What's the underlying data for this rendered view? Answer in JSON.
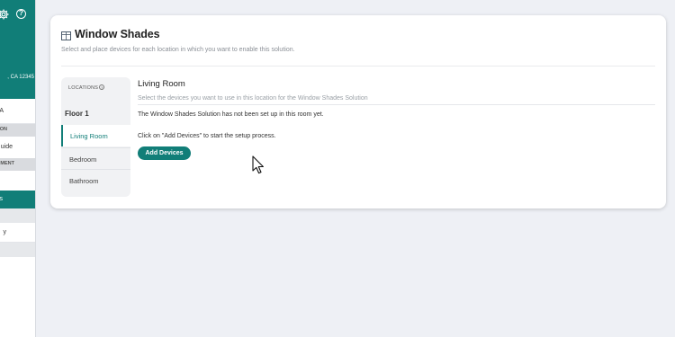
{
  "sidebar": {
    "address_fragment": ", CA 12345",
    "row_a": "A",
    "section_1": "ON",
    "row_uide": "uide",
    "section_2": "MENT",
    "row_s": "s",
    "row_y": "y",
    "accent_color": "#117e78"
  },
  "card": {
    "title": "Window Shades",
    "subtitle": "Select and place devices for each location in which you want to enable this solution."
  },
  "locations": {
    "header": "LOCATIONS",
    "help_glyph": "?",
    "floor": "Floor 1",
    "rooms": [
      "Living Room",
      "Bedroom",
      "Bathroom"
    ],
    "selected_room": "Living Room"
  },
  "room": {
    "title": "Living Room",
    "subtitle": "Select the devices you want to use in this location for the Window Shades Solution",
    "message_not_setup": "The Window Shades Solution has not been set up in this room yet.",
    "message_instruction": "Click on \"Add Devices\" to start the setup process.",
    "add_button": "Add Devices"
  },
  "icons": {
    "settings": "gear-icon",
    "help": "help-icon",
    "window": "window-shades-icon",
    "cursor": "mouse-pointer-icon"
  }
}
